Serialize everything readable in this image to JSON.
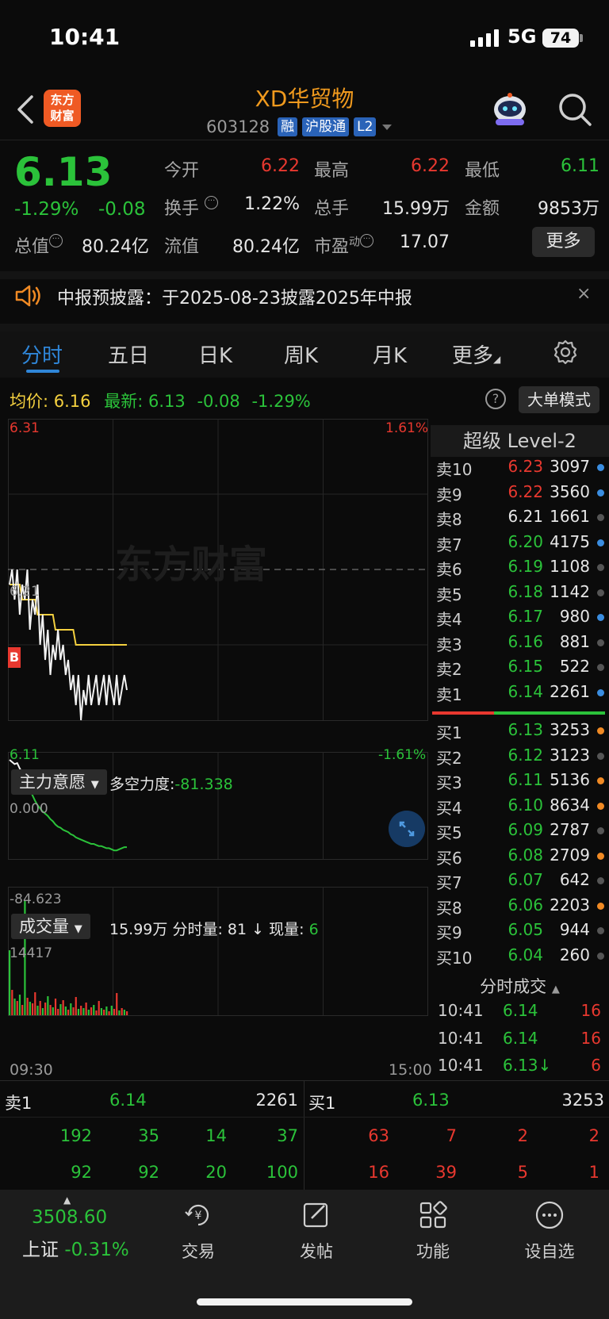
{
  "status_bar": {
    "time": "10:41",
    "network": "5G",
    "battery": "74"
  },
  "header": {
    "logo_line1": "东方",
    "logo_line2": "财富",
    "stock_name": "XD华贸物",
    "code": "603128",
    "tags": [
      "融",
      "沪股通",
      "L2"
    ]
  },
  "quote": {
    "price": "6.13",
    "change_pct": "-1.29%",
    "change_amt": "-0.08",
    "open_label": "今开",
    "open": "6.22",
    "high_label": "最高",
    "high": "6.22",
    "low_label": "最低",
    "low": "6.11",
    "turnover_label": "换手",
    "turnover": "1.22%",
    "volume_label": "总手",
    "volume": "15.99万",
    "amount_label": "金额",
    "amount": "9853万",
    "mktcap_label": "总值",
    "mktcap": "80.24亿",
    "float_label": "流值",
    "float": "80.24亿",
    "pe_label": "市盈",
    "pe_sup": "动",
    "pe": "17.07",
    "more": "更多"
  },
  "notice": {
    "text": "中报预披露：于2025-08-23披露2025年中报",
    "close": "×"
  },
  "tabs": [
    "分时",
    "五日",
    "日K",
    "周K",
    "月K",
    "更多"
  ],
  "info_line": {
    "avg_label": "均价:",
    "avg": "6.16",
    "latest_label": "最新:",
    "latest": "6.13",
    "latest_chg": "-0.08",
    "latest_pct": "-1.29%",
    "help": "?",
    "big_order": "大单模式"
  },
  "chart_data": {
    "type": "line",
    "price_axis": {
      "top": "6.31",
      "mid": "6.21",
      "bottom": "6.11",
      "top_pct": "1.61%",
      "bottom_pct": "-1.61%",
      "ylim": [
        6.11,
        6.31
      ],
      "prev_close": 6.21
    },
    "time_start": "09:30",
    "time_end": "15:00",
    "watermark": "东方财富",
    "marker": "B",
    "price_series": [
      6.2,
      6.21,
      6.19,
      6.21,
      6.18,
      6.2,
      6.19,
      6.21,
      6.17,
      6.19,
      6.18,
      6.2,
      6.16,
      6.18,
      6.15,
      6.17,
      6.14,
      6.16,
      6.15,
      6.17,
      6.15,
      6.16,
      6.14,
      6.15,
      6.13,
      6.14,
      6.12,
      6.14,
      6.11,
      6.13,
      6.12,
      6.14,
      6.12,
      6.13,
      6.14,
      6.12,
      6.13,
      6.14,
      6.12,
      6.14,
      6.13,
      6.12,
      6.14,
      6.12,
      6.13,
      6.14,
      6.13
    ],
    "avg_series": [
      6.2,
      6.2,
      6.2,
      6.2,
      6.2,
      6.19,
      6.19,
      6.19,
      6.19,
      6.19,
      6.19,
      6.18,
      6.18,
      6.18,
      6.18,
      6.18,
      6.18,
      6.18,
      6.17,
      6.17,
      6.17,
      6.17,
      6.17,
      6.17,
      6.17,
      6.17,
      6.16,
      6.16,
      6.16,
      6.16,
      6.16,
      6.16,
      6.16,
      6.16,
      6.16,
      6.16,
      6.16,
      6.16,
      6.16,
      6.16,
      6.16,
      6.16,
      6.16,
      6.16,
      6.16,
      6.16,
      6.16
    ],
    "main_force": {
      "selector": "主力意愿",
      "label": "多空力度:",
      "value": "-81.338",
      "axis_top": "0.000",
      "axis_bottom": "-84.623",
      "ylim": [
        -84.623,
        0
      ],
      "series": [
        0,
        -2,
        -4,
        -3,
        -8,
        -12,
        -18,
        -22,
        -28,
        -33,
        -38,
        -42,
        -45,
        -48,
        -50,
        -52,
        -55,
        -57,
        -60,
        -62,
        -63,
        -65,
        -66,
        -67,
        -69,
        -70,
        -72,
        -73,
        -74,
        -75,
        -76,
        -77,
        -78,
        -78,
        -79,
        -80,
        -80,
        -81,
        -82,
        -82,
        -83,
        -84,
        -84,
        -83,
        -82,
        -81,
        -81
      ]
    },
    "volume": {
      "selector": "成交量",
      "total": "15.99万",
      "min_label": "分时量:",
      "min_value": "81",
      "now_label": "现量:",
      "now_value": "6",
      "axis_top": "14417",
      "max": 14417,
      "bars": [
        8200,
        3200,
        2100,
        1800,
        2600,
        1300,
        14417,
        2200,
        1700,
        1500,
        2900,
        1200,
        1800,
        900,
        1600,
        2400,
        1300,
        1000,
        2100,
        800,
        1400,
        1900,
        1100,
        700,
        1500,
        1000,
        2300,
        800,
        1200,
        900,
        1600,
        700,
        1000,
        1300,
        600,
        1800,
        900,
        700,
        1100,
        500,
        1200,
        800,
        2800,
        600,
        900,
        700,
        500
      ],
      "bar_colors": [
        "g",
        "r",
        "g",
        "r",
        "g",
        "r",
        "g",
        "r",
        "g",
        "r",
        "r",
        "g",
        "r",
        "g",
        "r",
        "g",
        "r",
        "g",
        "r",
        "r",
        "g",
        "r",
        "g",
        "r",
        "g",
        "r",
        "r",
        "g",
        "r",
        "g",
        "r",
        "g",
        "r",
        "g",
        "r",
        "r",
        "g",
        "r",
        "g",
        "r",
        "g",
        "r",
        "r",
        "g",
        "r",
        "g",
        "r"
      ]
    }
  },
  "order_book": {
    "title": "超级 Level-2",
    "asks": [
      {
        "label": "卖10",
        "price": "6.23",
        "vol": "3097",
        "color": "#e8382f",
        "dot": "#3a8de0"
      },
      {
        "label": "卖9",
        "price": "6.22",
        "vol": "3560",
        "color": "#e8382f",
        "dot": "#3a8de0"
      },
      {
        "label": "卖8",
        "price": "6.21",
        "vol": "1661",
        "color": "#e6e6e6",
        "dot": "#555555"
      },
      {
        "label": "卖7",
        "price": "6.20",
        "vol": "4175",
        "color": "#2bc23a",
        "dot": "#3a8de0"
      },
      {
        "label": "卖6",
        "price": "6.19",
        "vol": "1108",
        "color": "#2bc23a",
        "dot": "#555555"
      },
      {
        "label": "卖5",
        "price": "6.18",
        "vol": "1142",
        "color": "#2bc23a",
        "dot": "#555555"
      },
      {
        "label": "卖4",
        "price": "6.17",
        "vol": "980",
        "color": "#2bc23a",
        "dot": "#3a8de0"
      },
      {
        "label": "卖3",
        "price": "6.16",
        "vol": "881",
        "color": "#2bc23a",
        "dot": "#555555"
      },
      {
        "label": "卖2",
        "price": "6.15",
        "vol": "522",
        "color": "#2bc23a",
        "dot": "#555555"
      },
      {
        "label": "卖1",
        "price": "6.14",
        "vol": "2261",
        "color": "#2bc23a",
        "dot": "#3a8de0"
      }
    ],
    "bids": [
      {
        "label": "买1",
        "price": "6.13",
        "vol": "3253",
        "color": "#2bc23a",
        "dot": "#f08a24"
      },
      {
        "label": "买2",
        "price": "6.12",
        "vol": "3123",
        "color": "#2bc23a",
        "dot": "#555555"
      },
      {
        "label": "买3",
        "price": "6.11",
        "vol": "5136",
        "color": "#2bc23a",
        "dot": "#f08a24"
      },
      {
        "label": "买4",
        "price": "6.10",
        "vol": "8634",
        "color": "#2bc23a",
        "dot": "#f08a24"
      },
      {
        "label": "买5",
        "price": "6.09",
        "vol": "2787",
        "color": "#2bc23a",
        "dot": "#555555"
      },
      {
        "label": "买6",
        "price": "6.08",
        "vol": "2709",
        "color": "#2bc23a",
        "dot": "#f08a24"
      },
      {
        "label": "买7",
        "price": "6.07",
        "vol": "642",
        "color": "#2bc23a",
        "dot": "#555555"
      },
      {
        "label": "买8",
        "price": "6.06",
        "vol": "2203",
        "color": "#2bc23a",
        "dot": "#f08a24"
      },
      {
        "label": "买9",
        "price": "6.05",
        "vol": "944",
        "color": "#2bc23a",
        "dot": "#555555"
      },
      {
        "label": "买10",
        "price": "6.04",
        "vol": "260",
        "color": "#2bc23a",
        "dot": "#555555"
      }
    ],
    "trades_title": "分时成交",
    "trades": [
      {
        "time": "10:41",
        "price": "6.14",
        "vol": "16"
      },
      {
        "time": "10:41",
        "price": "6.14",
        "vol": "16"
      },
      {
        "time": "10:41",
        "price": "6.13↓",
        "vol": "6"
      }
    ]
  },
  "level1": {
    "ask_label": "卖1",
    "ask_price": "6.14",
    "ask_vol": "2261",
    "bid_label": "买1",
    "bid_price": "6.13",
    "bid_vol": "3253",
    "ask_queue_row1": [
      "192",
      "35",
      "14",
      "37"
    ],
    "ask_queue_row2": [
      "92",
      "92",
      "20",
      "100"
    ],
    "bid_queue_row1": [
      "63",
      "7",
      "2",
      "2"
    ],
    "bid_queue_row2": [
      "16",
      "39",
      "5",
      "1"
    ]
  },
  "bottom_nav": {
    "index_value": "3508.60",
    "index_name": "上证",
    "index_pct": "-0.31%",
    "items": [
      "交易",
      "发帖",
      "功能",
      "设自选"
    ]
  }
}
